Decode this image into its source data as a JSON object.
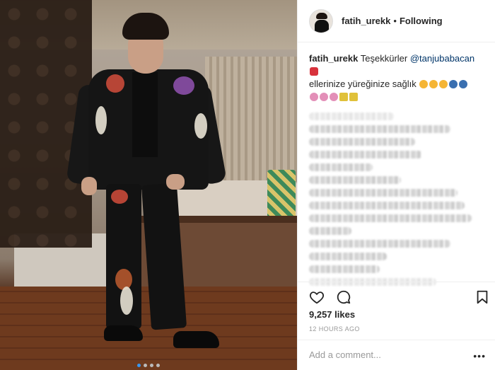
{
  "header": {
    "username": "fatih_urekk",
    "separator": "•",
    "follow_status": "Following"
  },
  "caption": {
    "username": "fatih_urekk",
    "text_1": "Teşekkürler",
    "mention": "@tanjubabacan",
    "text_2": "ellerinize yüreğinize sağlık"
  },
  "post": {
    "likes": "9,257 likes",
    "timestamp": "12 HOURS AGO",
    "comment_placeholder": "Add a comment...",
    "more_label": "•••",
    "carousel_dots": 4,
    "active_dot": 1
  },
  "icons": {
    "like": "heart-icon",
    "comment": "comment-icon",
    "save": "bookmark-icon"
  },
  "colors": {
    "link": "#003569",
    "border": "#efefef",
    "muted": "#999999",
    "dot_active": "#3897f0"
  }
}
